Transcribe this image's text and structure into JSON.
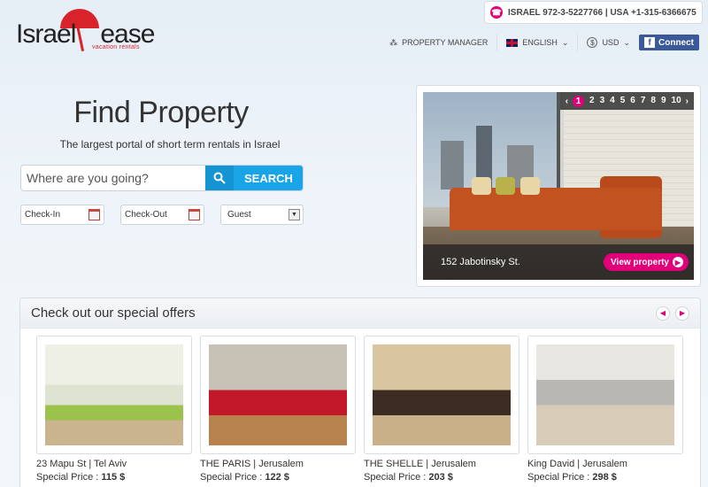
{
  "brand": {
    "logo_text_1": "Israel",
    "logo_text_2": "ease",
    "tagline": "vacation rentals"
  },
  "contact": {
    "text": "ISRAEL 972-3-5227766  |  USA +1-315-6366675"
  },
  "nav": {
    "property_manager": "PROPERTY MANAGER",
    "language": "ENGLISH",
    "currency": "USD",
    "connect": "Connect",
    "fb": "f"
  },
  "hero": {
    "title": "Find Property",
    "subtitle": "The largest portal of short term rentals in Israel",
    "search_placeholder": "Where are you going?",
    "search_button": "SEARCH",
    "checkin": "Check-In",
    "checkout": "Check-Out",
    "guest": "Guest"
  },
  "featured": {
    "pages": [
      "1",
      "2",
      "3",
      "4",
      "5",
      "6",
      "7",
      "8",
      "9",
      "10"
    ],
    "current_page": "1",
    "address": "152 Jabotinsky St.",
    "view_button": "View property"
  },
  "offers": {
    "title": "Check out our special offers",
    "price_label": "Special Price :",
    "items": [
      {
        "name": "23 Mapu St | Tel Aviv",
        "price": "115 $"
      },
      {
        "name": "THE PARIS | Jerusalem",
        "price": "122 $"
      },
      {
        "name": "THE SHELLE | Jerusalem",
        "price": "203 $"
      },
      {
        "name": "King David | Jerusalem",
        "price": "298 $"
      }
    ]
  },
  "colors": {
    "accent": "#e2007a",
    "search": "#1aa4e8",
    "facebook": "#3b5998",
    "logo_red": "#d8232a"
  },
  "icons": [
    "phone-icon",
    "users-icon",
    "uk-flag-icon",
    "dollar-icon",
    "facebook-icon",
    "search-icon",
    "calendar-icon",
    "chevron-left-icon",
    "chevron-right-icon",
    "arrow-right-circle-icon"
  ]
}
